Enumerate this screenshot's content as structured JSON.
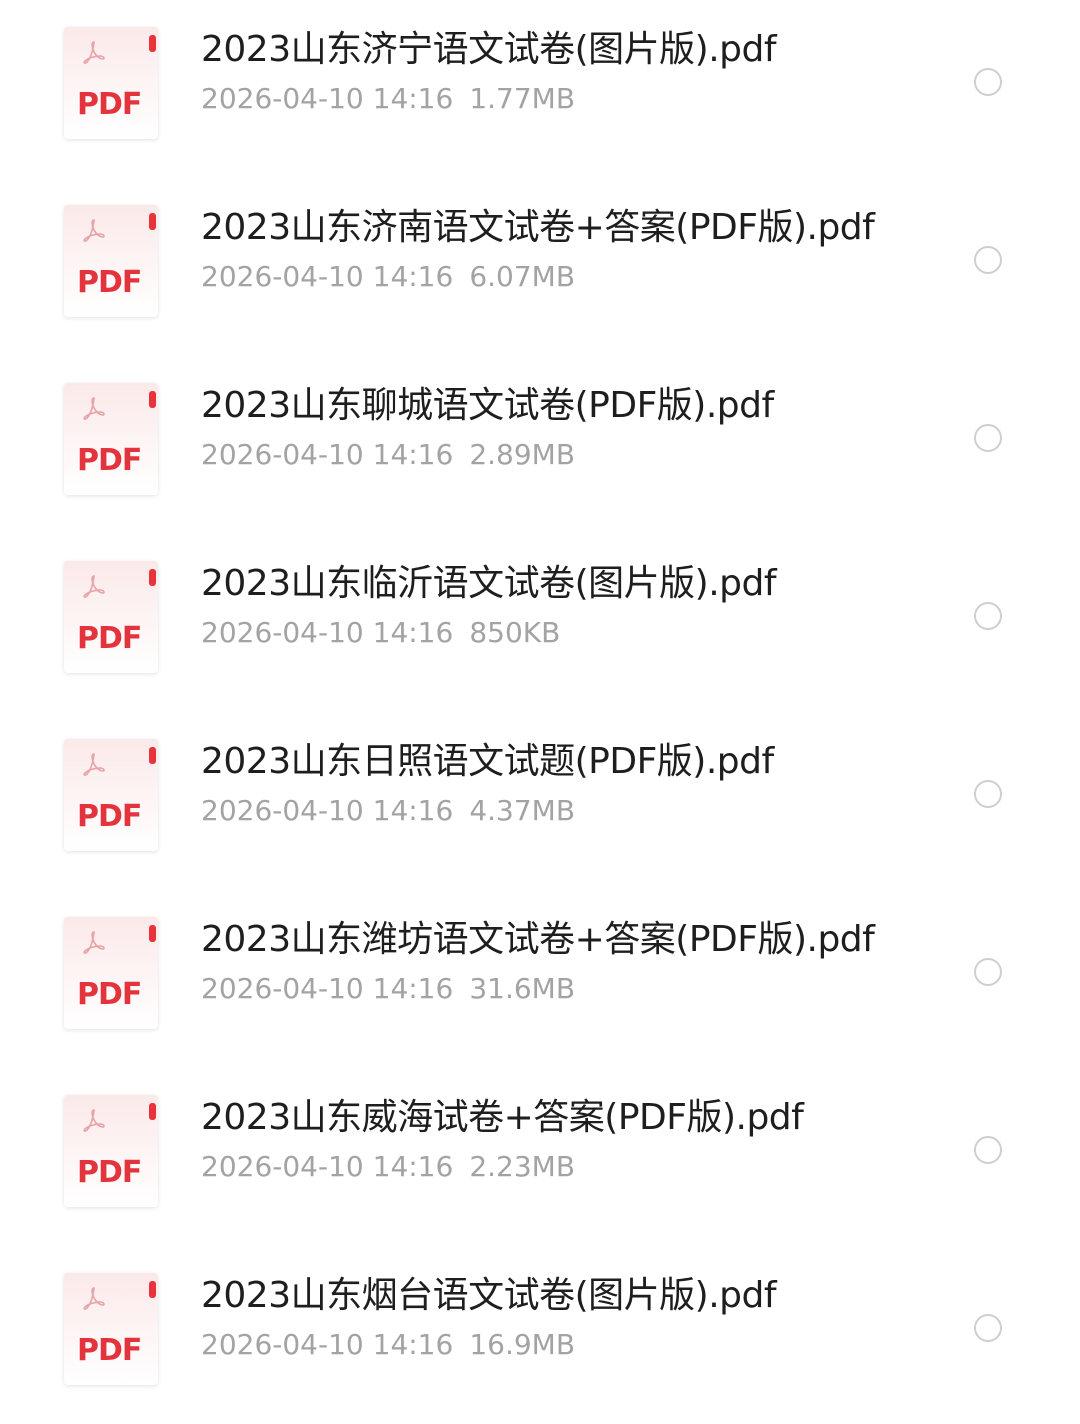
{
  "icon_label": "PDF",
  "colors": {
    "pdf_red": "#e3343d",
    "meta_gray": "#a3a3a3",
    "name_black": "#1e1e1e"
  },
  "files": [
    {
      "name": "2023山东济宁语文试卷(图片版).pdf",
      "date": "2026-04-10 14:16",
      "size": "1.77MB",
      "selected": false
    },
    {
      "name": "2023山东济南语文试卷+答案(PDF版).pdf",
      "date": "2026-04-10 14:16",
      "size": "6.07MB",
      "selected": false
    },
    {
      "name": "2023山东聊城语文试卷(PDF版).pdf",
      "date": "2026-04-10 14:16",
      "size": "2.89MB",
      "selected": false
    },
    {
      "name": "2023山东临沂语文试卷(图片版).pdf",
      "date": "2026-04-10 14:16",
      "size": "850KB",
      "selected": false
    },
    {
      "name": "2023山东日照语文试题(PDF版).pdf",
      "date": "2026-04-10 14:16",
      "size": "4.37MB",
      "selected": false
    },
    {
      "name": "2023山东潍坊语文试卷+答案(PDF版).pdf",
      "date": "2026-04-10 14:16",
      "size": "31.6MB",
      "selected": false
    },
    {
      "name": "2023山东威海试卷+答案(PDF版).pdf",
      "date": "2026-04-10 14:16",
      "size": "2.23MB",
      "selected": false
    },
    {
      "name": "2023山东烟台语文试卷(图片版).pdf",
      "date": "2026-04-10 14:16",
      "size": "16.9MB",
      "selected": false
    }
  ]
}
